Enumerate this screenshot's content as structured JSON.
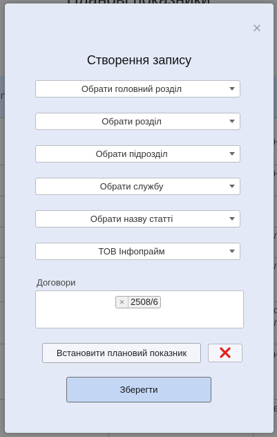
{
  "background": {
    "page_title": "Планові показники",
    "edge_texts": [
      "П",
      "Н",
      "Н",
      "Л",
      "Л",
      "С",
      "Л",
      "Н",
      "Е"
    ]
  },
  "modal": {
    "close_symbol": "×",
    "title": "Створення запису",
    "selects": [
      {
        "label": "Обрати головний розділ"
      },
      {
        "label": "Обрати розділ"
      },
      {
        "label": "Обрати підрозділ"
      },
      {
        "label": "Обрати службу"
      },
      {
        "label": "Обрати назву статті"
      },
      {
        "label": "ТОВ Інфопрайм"
      }
    ],
    "contracts": {
      "label": "Договори",
      "tags": [
        {
          "remove": "×",
          "value": "2508/6"
        }
      ]
    },
    "set_indicator_label": "Встановити плановий показник",
    "save_label": "Зберегти",
    "delete_color": "#e0211a"
  }
}
